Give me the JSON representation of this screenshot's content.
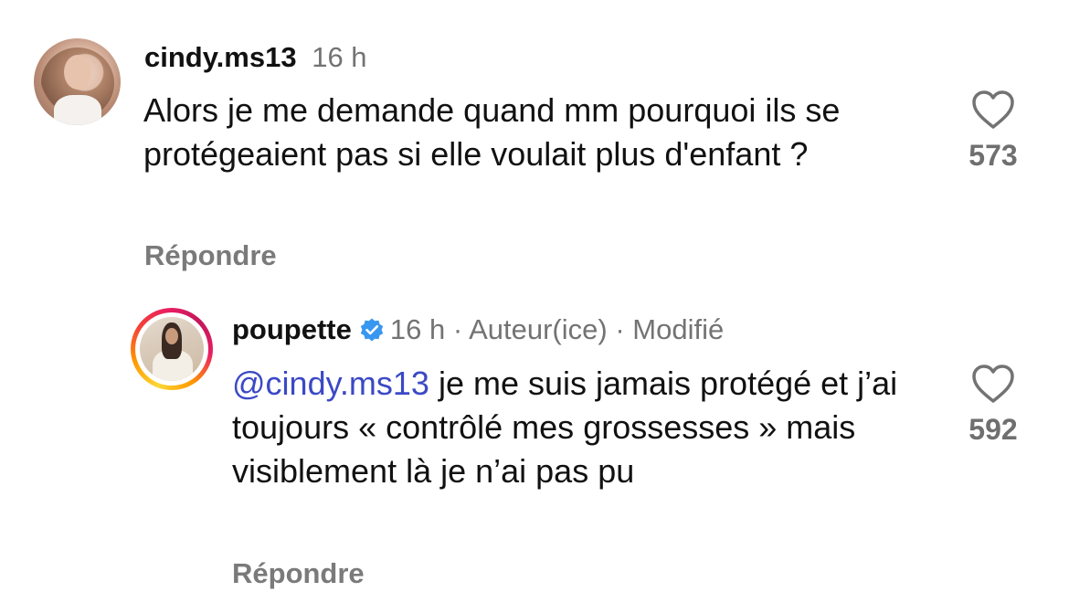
{
  "comments": [
    {
      "username": "cindy.ms13",
      "time": "16 h",
      "text": "Alors je me demande quand mm pourquoi ils se protégeaient pas si elle voulait plus d'enfant ?",
      "reply_label": "Répondre",
      "likes": "573"
    },
    {
      "username": "poupette",
      "time": "16 h",
      "author_tag": "Auteur(ice)",
      "edited_tag": "Modifié",
      "separator": "·",
      "mention": "@cindy.ms13",
      "text": " je me suis jamais protégé et j’ai toujours «  contrôlé mes grossesses » mais visiblement là je n’ai pas pu",
      "reply_label": "Répondre",
      "likes": "592"
    }
  ],
  "colors": {
    "mention": "#3b49c5",
    "verified_badge": "#3897f0",
    "muted_text": "#737373"
  },
  "icons": {
    "like": "heart-outline-icon",
    "verified": "verified-badge-icon"
  }
}
